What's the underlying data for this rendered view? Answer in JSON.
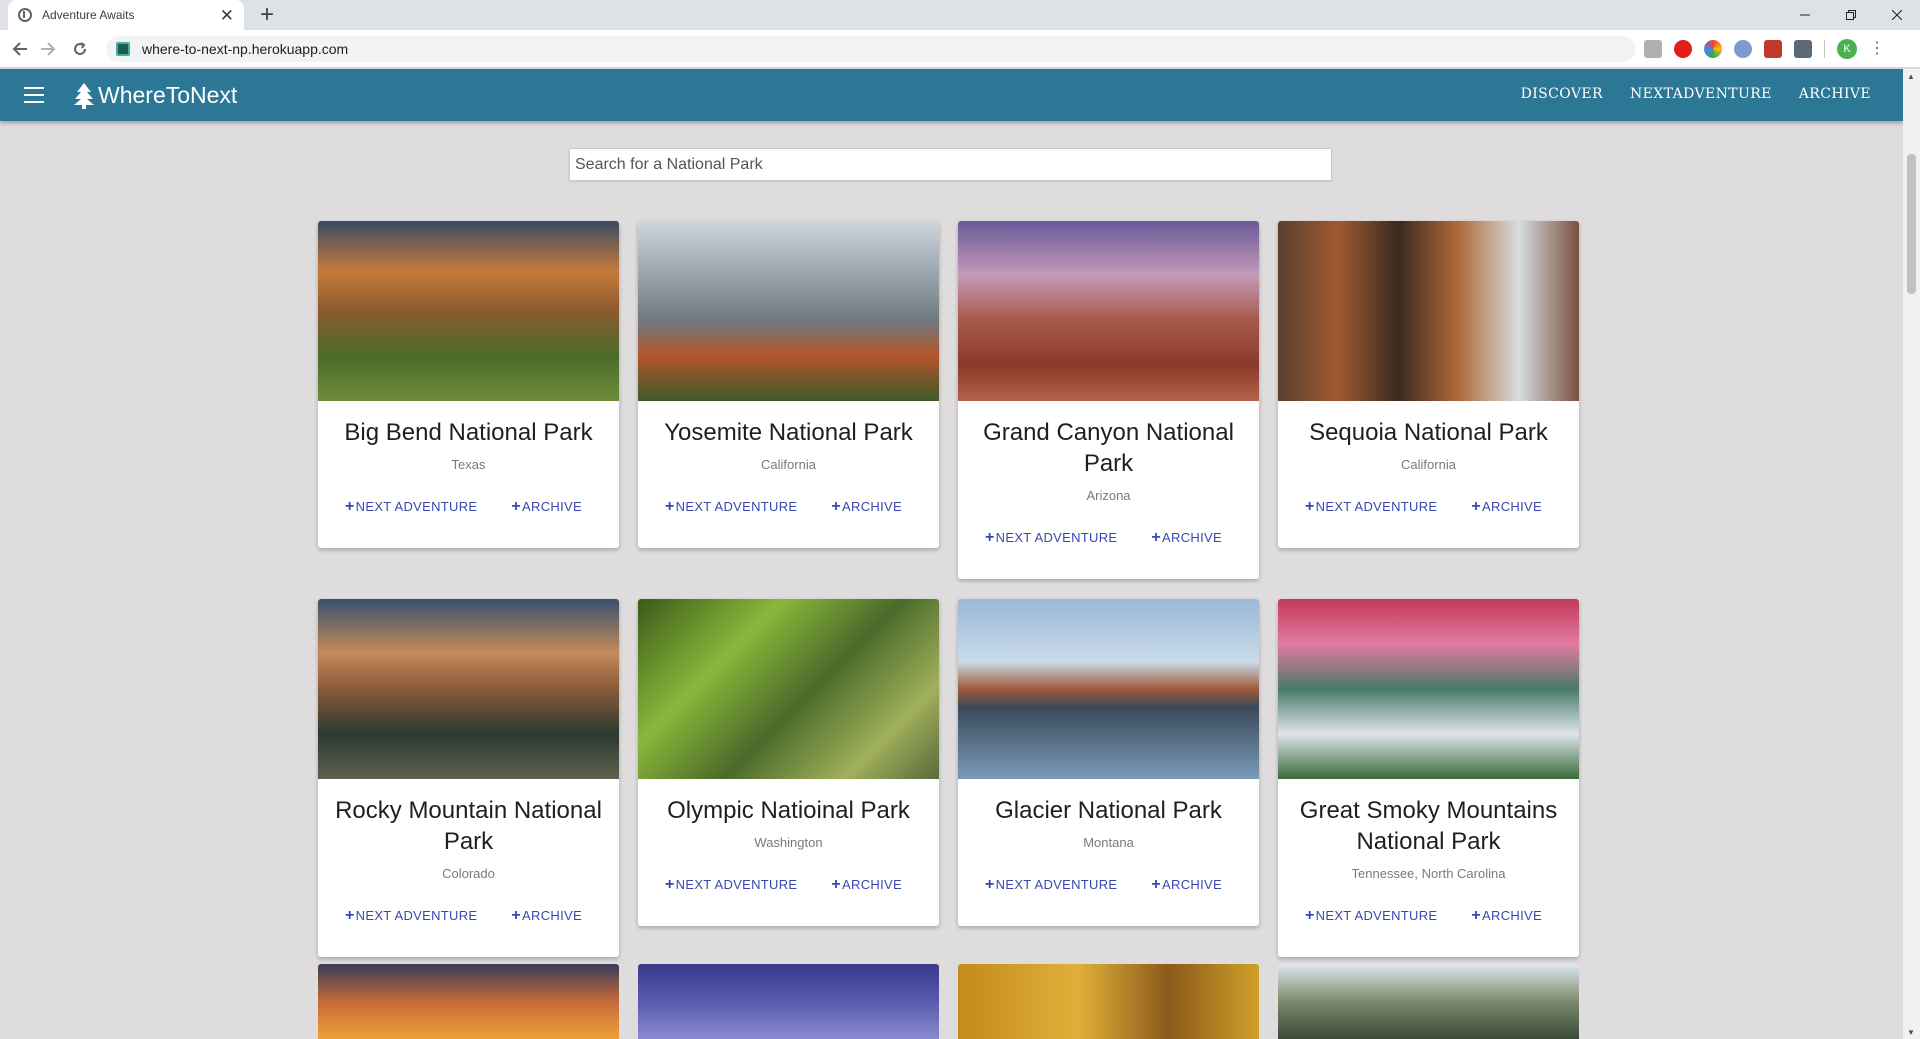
{
  "browser": {
    "tab_title": "Adventure Awaits",
    "new_tab": "+",
    "close_tab": "✕",
    "url": "where-to-next-np.herokuapp.com",
    "profile_initial": "K"
  },
  "navbar": {
    "brand": "WhereToNext",
    "links": [
      "DISCOVER",
      "NEXTADVENTURE",
      "ARCHIVE"
    ],
    "color": "#2c7796"
  },
  "search": {
    "placeholder": "Search for a National Park",
    "value": ""
  },
  "parks": [
    {
      "name": "Big Bend National Park",
      "state": "Texas",
      "image": "big-bend-canyon"
    },
    {
      "name": "Yosemite National Park",
      "state": "California",
      "image": "yosemite-valley"
    },
    {
      "name": "Grand Canyon National Park",
      "state": "Arizona",
      "image": "grand-canyon"
    },
    {
      "name": "Sequoia National Park",
      "state": "California",
      "image": "sequoia-trees"
    },
    {
      "name": "Rocky Mountain National Park",
      "state": "Colorado",
      "image": "rocky-mountain-lake"
    },
    {
      "name": "Olympic Natioinal Park",
      "state": "Washington",
      "image": "olympic-forest"
    },
    {
      "name": "Glacier National Park",
      "state": "Montana",
      "image": "glacier-reflection"
    },
    {
      "name": "Great Smoky Mountains National Park",
      "state": "Tennessee, North Carolina",
      "image": "smoky-mountains"
    }
  ],
  "actions": {
    "next_adventure": "NEXT ADVENTURE",
    "archive": "ARCHIVE",
    "plus": "+"
  },
  "colors": {
    "action": "#3949ab",
    "page_bg": "#dedcdc"
  }
}
